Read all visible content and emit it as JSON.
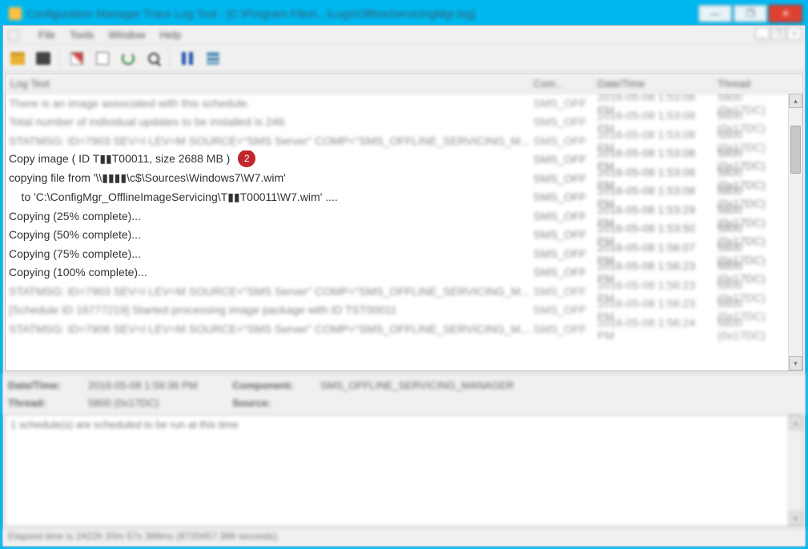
{
  "window": {
    "title": "Configuration Manager Trace Log Tool - [C:\\Program Files\\...\\Logs\\OfflineServicingMgr.log]"
  },
  "menubar": [
    "File",
    "Tools",
    "Window",
    "Help"
  ],
  "columns": {
    "text": "Log Text",
    "comp": "Com...",
    "date": "Date/Time",
    "thread": "Thread"
  },
  "callout": {
    "number": "2"
  },
  "rows": [
    {
      "text": "There is an image associated with this schedule.",
      "comp": "SMS_OFF",
      "date": "2016-05-08 1:53:08 PM",
      "thread": "5800 (0x17DC)",
      "blurred": true
    },
    {
      "text": "Total number of individual updates to be installed is 246.",
      "comp": "SMS_OFF",
      "date": "2016-05-08 1:53:08 PM",
      "thread": "5800 (0x17DC)",
      "blurred": true
    },
    {
      "text": "STATMSG: ID=7903 SEV=I LEV=M SOURCE=\"SMS Server\" COMP=\"SMS_OFFLINE_SERVICING_M...",
      "comp": "SMS_OFF",
      "date": "2016-05-08 1:53:08 PM",
      "thread": "5800 (0x17DC)",
      "blurred": true
    },
    {
      "text": "Copy image ( ID T▮▮T00011, size 2688 MB ) ",
      "comp": "SMS_OFF",
      "date": "2016-05-08 1:53:08 PM",
      "thread": "5800 (0x17DC)",
      "blurred": false,
      "hasBadge": true
    },
    {
      "text": "copying file from '\\\\▮▮▮▮\\c$\\Sources\\Windows7\\W7.wim'",
      "comp": "SMS_OFF",
      "date": "2016-05-08 1:53:08 PM",
      "thread": "5800 (0x17DC)",
      "blurred": false
    },
    {
      "text": "    to 'C:\\ConfigMgr_OfflineImageServicing\\T▮▮T00011\\W7.wim' ....",
      "comp": "SMS_OFF",
      "date": "2016-05-08 1:53:08 PM",
      "thread": "5800 (0x17DC)",
      "blurred": false
    },
    {
      "text": "Copying (25% complete)...",
      "comp": "SMS_OFF",
      "date": "2016-05-08 1:53:29 PM",
      "thread": "5800 (0x17DC)",
      "blurred": false
    },
    {
      "text": "Copying (50% complete)...",
      "comp": "SMS_OFF",
      "date": "2016-05-08 1:53:50 PM",
      "thread": "5800 (0x17DC)",
      "blurred": false
    },
    {
      "text": "Copying (75% complete)...",
      "comp": "SMS_OFF",
      "date": "2016-05-08 1:56:07 PM",
      "thread": "5800 (0x17DC)",
      "blurred": false
    },
    {
      "text": "Copying (100% complete)...",
      "comp": "SMS_OFF",
      "date": "2016-05-08 1:56:23 PM",
      "thread": "5800 (0x17DC)",
      "blurred": false
    },
    {
      "text": "STATMSG: ID=7903 SEV=I LEV=M SOURCE=\"SMS Server\" COMP=\"SMS_OFFLINE_SERVICING_M...",
      "comp": "SMS_OFF",
      "date": "2016-05-08 1:56:23 PM",
      "thread": "5800 (0x17DC)",
      "blurred": true
    },
    {
      "text": "[Schedule ID 16777219] Started processing image package with ID TST00011",
      "comp": "SMS_OFF",
      "date": "2016-05-08 1:56:23 PM",
      "thread": "5800 (0x17DC)",
      "blurred": true
    },
    {
      "text": "STATMSG: ID=7906 SEV=I LEV=M SOURCE=\"SMS Server\" COMP=\"SMS_OFFLINE_SERVICING_M...",
      "comp": "SMS_OFF",
      "date": "2016-05-08 1:56:24 PM",
      "thread": "5800 (0x17DC)",
      "blurred": true
    }
  ],
  "detail": {
    "dt_label": "Date/Time:",
    "dt_value": "2016-05-08 1:59:36 PM",
    "comp_label": "Component:",
    "comp_value": "SMS_OFFLINE_SERVICING_MANAGER",
    "th_label": "Thread:",
    "th_value": "5800 (0x17DC)",
    "src_label": "Source:",
    "src_value": ""
  },
  "message_text": "1 schedule(s) are scheduled to be run at this time",
  "status": "Elapsed time is 2422h 20m 57s 389ms (8720457.389 seconds)"
}
